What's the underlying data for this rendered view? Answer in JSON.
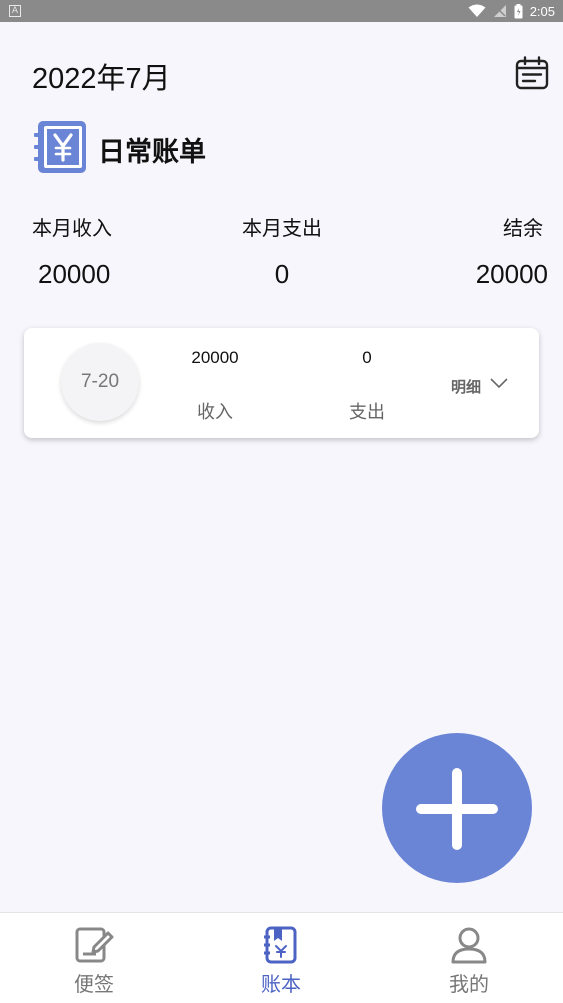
{
  "status_bar": {
    "app_glyph": "A",
    "time": "2:05"
  },
  "header": {
    "month_title": "2022年7月",
    "calendar_icon": "calendar-icon"
  },
  "book": {
    "logo_icon": "yen-book-icon",
    "title": "日常账单"
  },
  "summary": {
    "income_label": "本月收入",
    "income_value": "20000",
    "expense_label": "本月支出",
    "expense_value": "0",
    "balance_label": "结余",
    "balance_value": "20000"
  },
  "days": [
    {
      "date": "7-20",
      "income_value": "20000",
      "income_label": "收入",
      "expense_value": "0",
      "expense_label": "支出",
      "detail_label": "明细",
      "expand_icon": "chevron-down-icon"
    }
  ],
  "fab": {
    "icon": "plus-icon"
  },
  "nav": {
    "items": [
      {
        "label": "便签",
        "icon": "note-icon",
        "active": false
      },
      {
        "label": "账本",
        "icon": "ledger-icon",
        "active": true
      },
      {
        "label": "我的",
        "icon": "profile-icon",
        "active": false
      }
    ],
    "active_color": "#4c63c4",
    "inactive_color": "#777777"
  },
  "colors": {
    "accent": "#6b85d6",
    "background": "#f6f6fc"
  }
}
